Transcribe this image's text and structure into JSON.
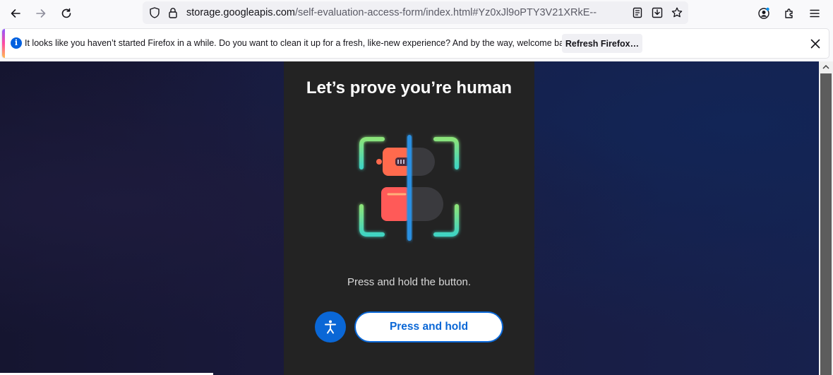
{
  "browser": {
    "url_host": "storage.googleapis.com",
    "url_path": "/self-evaluation-access-form/index.html#Yz0xJl9oPTY3V21XRkE--",
    "icons": {
      "back": "back-arrow-icon",
      "forward": "forward-arrow-icon",
      "reload": "reload-icon",
      "shield": "tracking-protection-shield-icon",
      "lock": "lock-icon",
      "reader": "reader-view-icon",
      "download": "save-to-pocket-icon",
      "bookmark": "bookmark-star-icon",
      "account": "account-icon",
      "extensions": "extensions-icon",
      "menu": "hamburger-menu-icon"
    }
  },
  "notification": {
    "message": "It looks like you haven’t started Firefox in a while. Do you want to clean it up for a fresh, like-new experience? And by the way, welcome back!",
    "button_label": "Refresh Firefox…"
  },
  "challenge": {
    "title": "Let’s prove you’re human",
    "instruction": "Press and hold the button.",
    "button_label": "Press and hold",
    "accessibility_icon": "accessibility-person-icon"
  },
  "colors": {
    "accent": "#0a67d6",
    "card_bg": "#232323",
    "page_bg": "#1a1a3d"
  }
}
